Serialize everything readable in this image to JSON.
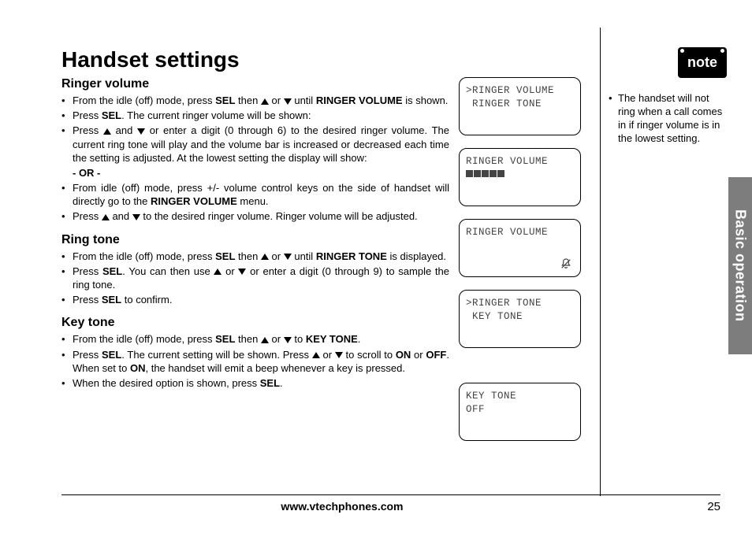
{
  "title": "Handset settings",
  "side_tab": "Basic operation",
  "sections": {
    "ringer_volume": {
      "heading": "Ringer volume",
      "b1a": "From the idle (off) mode, press ",
      "b1b": " then  ",
      "b1c": " or ",
      "b1d": " until ",
      "b1e": " is shown.",
      "sel": "SEL",
      "rv": "RINGER VOLUME",
      "b2a": "Press ",
      "b2b": ". The current ringer volume will be shown:",
      "b3a": "Press ",
      "b3b": " and ",
      "b3c": " or enter a digit (0 through 6) to the desired ringer volume. The current ring tone will play and the volume bar is increased or decreased each time the setting is adjusted. At the lowest setting the display will show:",
      "or": "- OR -",
      "b4a": "From idle (off) mode, press +/- volume control keys on the side of handset will directly go to the ",
      "b4b": " menu.",
      "b5a": "Press ",
      "b5b": " and ",
      "b5c": "  to the desired ringer volume. Ringer volume will be adjusted."
    },
    "ring_tone": {
      "heading": "Ring tone",
      "b1a": "From the idle (off) mode, press ",
      "b1b": " then ",
      "b1c": " or ",
      "b1d": " until ",
      "rt": "RINGER TONE",
      "b1e": " is displayed.",
      "b2a": "Press ",
      "b2b": ". You can then use ",
      "b2c": " or ",
      "b2d": " or enter a digit (0 through 9) to sample the ring tone.",
      "b3a": "Press ",
      "b3b": " to confirm."
    },
    "key_tone": {
      "heading": "Key tone",
      "b1a": "From the idle (off) mode, press ",
      "b1b": " then ",
      "b1c": " or ",
      "b1d": " to ",
      "kt": "KEY TONE",
      "b1e": ".",
      "b2a": "Press ",
      "b2b": ". The current setting will be shown. Press ",
      "b2c": " or ",
      "b2d": " to scroll to ",
      "on": "ON",
      "or_w": " or ",
      "off": "OFF",
      "b2e": ". When set to ",
      "b2f": ", the handset will emit a beep whenever a key is pressed.",
      "b3": "When the desired option is shown, press ",
      "b3b": "."
    }
  },
  "lcds": {
    "s1_l1": ">RINGER VOLUME",
    "s1_l2": " RINGER TONE",
    "s2_l1": "RINGER VOLUME",
    "s3_l1": "RINGER VOLUME",
    "s4_l1": ">RINGER TONE",
    "s4_l2": " KEY TONE",
    "s5_l1": "KEY TONE",
    "s5_l2": "OFF"
  },
  "note": {
    "badge": "note",
    "text": "The handset will not ring when a call comes in if ringer volume is in the lowest setting."
  },
  "footer": {
    "url": "www.vtechphones.com",
    "page": "25"
  }
}
